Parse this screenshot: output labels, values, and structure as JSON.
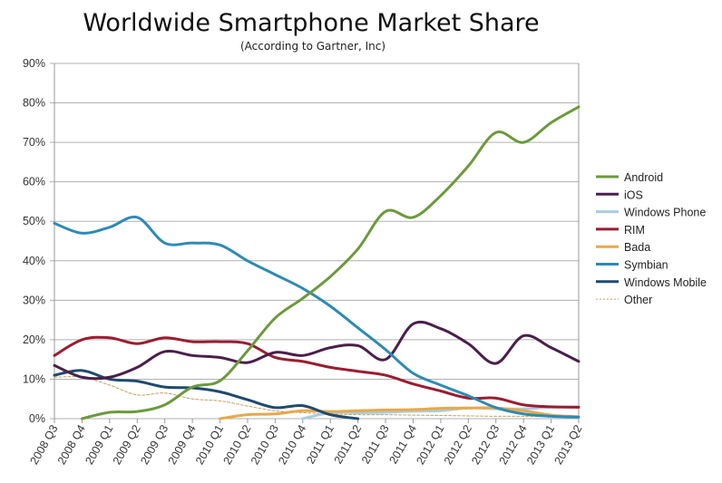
{
  "chart_data": {
    "type": "line",
    "title": "Worldwide Smartphone Market Share",
    "subtitle": "(According to Gartner, Inc)",
    "xlabel": "",
    "ylabel": "",
    "ylim": [
      0,
      90
    ],
    "yticks": [
      "0%",
      "10%",
      "20%",
      "30%",
      "40%",
      "50%",
      "60%",
      "70%",
      "80%",
      "90%"
    ],
    "grid": true,
    "legend_position": "right",
    "categories": [
      "2008 Q3",
      "2008 Q4",
      "2009 Q1",
      "2009 Q2",
      "2009 Q3",
      "2009 Q4",
      "2010 Q1",
      "2010 Q2",
      "2010 Q3",
      "2010 Q4",
      "2011 Q1",
      "2011 Q2",
      "2011 Q3",
      "2011 Q4",
      "2012 Q1",
      "2012 Q2",
      "2012 Q3",
      "2012 Q4",
      "2013 Q1",
      "2013 Q2"
    ],
    "series": [
      {
        "name": "Android",
        "color": "#6b9a3c",
        "dashed": false,
        "start": 1,
        "values": [
          null,
          0.0,
          1.6,
          1.8,
          3.5,
          8.0,
          9.6,
          17.2,
          25.5,
          30.5,
          36.0,
          43.0,
          52.5,
          51.0,
          56.5,
          64.0,
          72.5,
          70.0,
          75.0,
          79.0
        ]
      },
      {
        "name": "iOS",
        "color": "#4a1f4a",
        "dashed": false,
        "start": 0,
        "values": [
          13.5,
          10.5,
          10.5,
          13.0,
          17.0,
          16.0,
          15.5,
          14.2,
          16.8,
          16.0,
          18.0,
          18.5,
          15.0,
          24.0,
          22.8,
          19.0,
          14.0,
          21.0,
          18.0,
          14.5
        ]
      },
      {
        "name": "Windows Phone",
        "color": "#a8cde0",
        "dashed": false,
        "start": 9,
        "values": [
          null,
          null,
          null,
          null,
          null,
          null,
          null,
          null,
          null,
          0.0,
          1.5,
          1.5,
          1.6,
          1.9,
          2.0,
          2.7,
          2.5,
          2.5,
          2.9,
          3.0
        ]
      },
      {
        "name": "RIM",
        "color": "#9b1c30",
        "dashed": false,
        "start": 0,
        "values": [
          16.0,
          20.0,
          20.5,
          19.0,
          20.5,
          19.5,
          19.5,
          19.0,
          15.5,
          14.5,
          13.0,
          12.0,
          11.0,
          8.8,
          7.0,
          5.2,
          5.2,
          3.5,
          3.0,
          2.9
        ]
      },
      {
        "name": "Bada",
        "color": "#e8a84a",
        "dashed": false,
        "start": 6,
        "values": [
          null,
          null,
          null,
          null,
          null,
          null,
          0.0,
          1.0,
          1.2,
          2.0,
          1.8,
          2.0,
          2.2,
          2.3,
          2.6,
          2.7,
          2.7,
          2.0,
          0.9,
          0.5
        ]
      },
      {
        "name": "Symbian",
        "color": "#2e8ab5",
        "dashed": false,
        "start": 0,
        "values": [
          49.5,
          47.0,
          48.5,
          51.0,
          44.5,
          44.5,
          44.0,
          40.0,
          36.5,
          33.0,
          28.5,
          23.0,
          17.5,
          11.5,
          8.5,
          5.8,
          2.8,
          1.2,
          0.6,
          0.4
        ]
      },
      {
        "name": "Windows Mobile",
        "color": "#1f4a6e",
        "dashed": false,
        "start": 0,
        "values": [
          11.0,
          12.2,
          10.0,
          9.5,
          8.0,
          7.8,
          6.8,
          4.8,
          2.8,
          3.3,
          1.0,
          0.0,
          null,
          null,
          null,
          null,
          null,
          null,
          null,
          null
        ]
      },
      {
        "name": "Other",
        "color": "#c8a060",
        "dashed": true,
        "start": 0,
        "values": [
          10.5,
          10.5,
          8.5,
          6.0,
          6.5,
          5.0,
          4.5,
          3.2,
          2.0,
          1.5,
          1.2,
          1.0,
          1.0,
          0.9,
          0.8,
          0.7,
          0.6,
          0.6,
          0.5,
          0.4
        ]
      }
    ]
  }
}
